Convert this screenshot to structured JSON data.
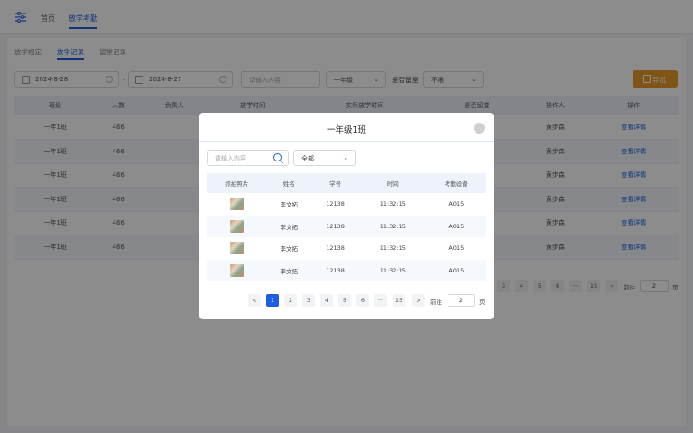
{
  "topbar": {
    "tabs": [
      {
        "label": "首页"
      },
      {
        "label": "放学考勤"
      }
    ]
  },
  "subtabs": [
    {
      "label": "放学规定"
    },
    {
      "label": "放学记录"
    },
    {
      "label": "留堂记录"
    }
  ],
  "filters": {
    "start_date": "2024-8-28",
    "end_date": "2024-8-27",
    "search_placeholder": "请输入内容",
    "grade": "一年级",
    "detain_label": "是否留堂",
    "detain_value": "不限",
    "export_label": "导出"
  },
  "main_table": {
    "columns": [
      "班级",
      "人数",
      "负责人",
      "放学时间",
      "实际放学时间",
      "是否留堂",
      "操作人",
      "操作"
    ],
    "rows": [
      {
        "class": "一年1班",
        "count": "466",
        "operator": "黄步森",
        "action": "查看详情"
      },
      {
        "class": "一年1班",
        "count": "466",
        "operator": "黄步森",
        "action": "查看详情"
      },
      {
        "class": "一年1班",
        "count": "466",
        "operator": "黄步森",
        "action": "查看详情"
      },
      {
        "class": "一年1班",
        "count": "466",
        "operator": "黄步森",
        "action": "查看详情"
      },
      {
        "class": "一年1班",
        "count": "466",
        "operator": "黄步森",
        "action": "查看详情"
      },
      {
        "class": "一年1班",
        "count": "466",
        "operator": "黄步森",
        "action": "查看详情"
      }
    ],
    "pager": {
      "pages": [
        "3",
        "4",
        "5",
        "6",
        "···",
        "15"
      ],
      "goto_prefix": "前往",
      "goto_value": "2",
      "goto_suffix": "页"
    }
  },
  "modal": {
    "title": "一年级1班",
    "search_placeholder": "请输入内容",
    "select_value": "全部",
    "columns": [
      "抓拍照片",
      "姓名",
      "学号",
      "时间",
      "考勤设备"
    ],
    "rows": [
      {
        "name": "李文拓",
        "id": "12138",
        "time": "11:32:15",
        "device": "A015"
      },
      {
        "name": "李文拓",
        "id": "12138",
        "time": "11:32:15",
        "device": "A015"
      },
      {
        "name": "李文拓",
        "id": "12138",
        "time": "11:32:15",
        "device": "A015"
      },
      {
        "name": "李文拓",
        "id": "12138",
        "time": "11:32:15",
        "device": "A015"
      }
    ],
    "pager": {
      "prev": "<",
      "next": ">",
      "pages": [
        "1",
        "2",
        "3",
        "4",
        "5",
        "6",
        "···",
        "15"
      ],
      "active_page": "1",
      "goto_prefix": "前往",
      "goto_value": "2",
      "goto_suffix": "页"
    }
  },
  "colors": {
    "primary": "#1d5fe0",
    "export": "#e69a2b",
    "overlay": "rgba(0,0,0,0.45)"
  }
}
